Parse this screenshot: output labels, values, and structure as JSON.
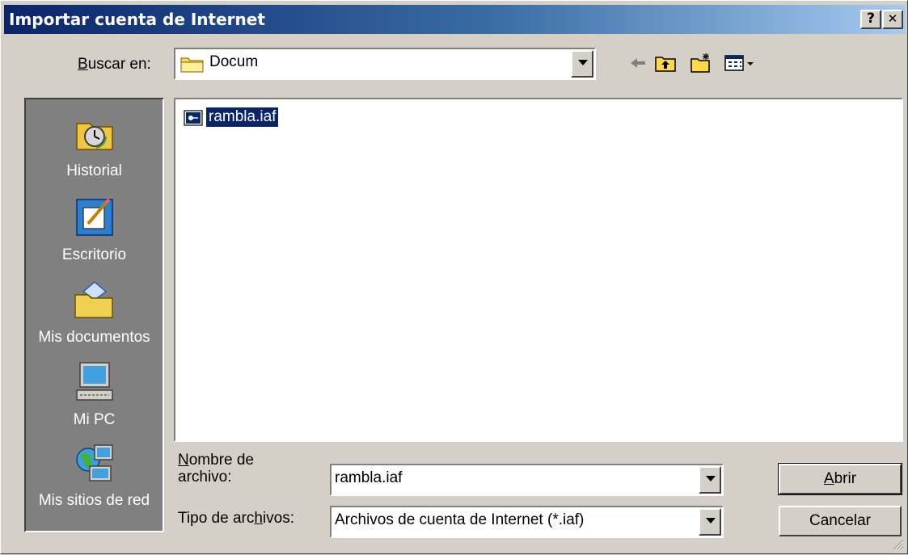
{
  "window": {
    "title": "Importar cuenta de Internet",
    "help_glyph": "?",
    "close_glyph": "✕"
  },
  "lookin": {
    "label_prefix": "",
    "label_hotkey": "B",
    "label_suffix": "uscar en:",
    "value": "Docum"
  },
  "toolbar": {
    "icons": [
      "back-arrow-icon",
      "up-one-level-icon",
      "new-folder-icon",
      "view-menu-icon"
    ]
  },
  "places": [
    {
      "label": "Historial",
      "icon": "history-icon"
    },
    {
      "label": "Escritorio",
      "icon": "desktop-icon"
    },
    {
      "label": "Mis documentos",
      "icon": "my-documents-icon"
    },
    {
      "label": "Mi PC",
      "icon": "my-computer-icon"
    },
    {
      "label": "Mis sitios de red",
      "icon": "network-places-icon"
    }
  ],
  "files": [
    {
      "name": "rambla.iaf",
      "icon": "iaf-file-icon",
      "selected": true
    }
  ],
  "filename": {
    "label_line1_hotkey": "N",
    "label_line1_rest": "ombre de",
    "label_line2": "archivo:",
    "value": "rambla.iaf"
  },
  "filetype": {
    "label_prefix": "Tipo de arc",
    "label_hotkey": "h",
    "label_suffix": "ivos:",
    "value": "Archivos de cuenta de Internet (*.iaf)"
  },
  "buttons": {
    "open_hotkey": "A",
    "open_rest": "brir",
    "cancel": "Cancelar"
  },
  "colors": {
    "title_start": "#0a246a",
    "title_end": "#a6caf0",
    "face": "#d4d0c8",
    "places_bg": "#808080",
    "selection": "#0a246a"
  }
}
